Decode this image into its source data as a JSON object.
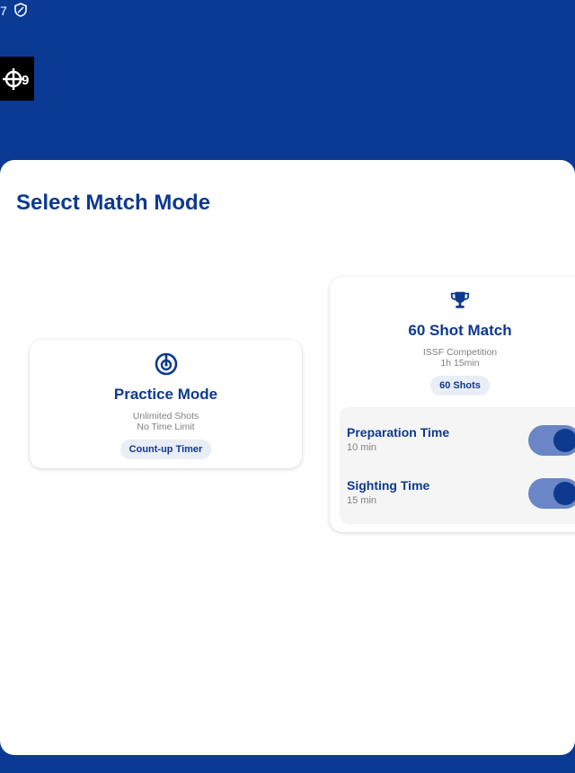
{
  "status_bar": {
    "time": "7"
  },
  "colors": {
    "primary": "#0d3a8f",
    "background": "#0b3a94",
    "chip_bg": "#e9edf6",
    "toggle_track": "#6a86c6"
  },
  "page": {
    "title": "Select Match Mode"
  },
  "modes": [
    {
      "icon": "radar-target-icon",
      "title": "Practice Mode",
      "details": [
        "Unlimited Shots",
        "No Time Limit"
      ],
      "chip": "Count-up Timer"
    },
    {
      "icon": "trophy-icon",
      "title": "60 Shot Match",
      "details": [
        "ISSF Competition",
        "1h 15min"
      ],
      "chip": "60 Shots",
      "options": [
        {
          "label": "Preparation Time",
          "value": "10 min",
          "enabled": true
        },
        {
          "label": "Sighting Time",
          "value": "15 min",
          "enabled": true
        }
      ]
    }
  ]
}
